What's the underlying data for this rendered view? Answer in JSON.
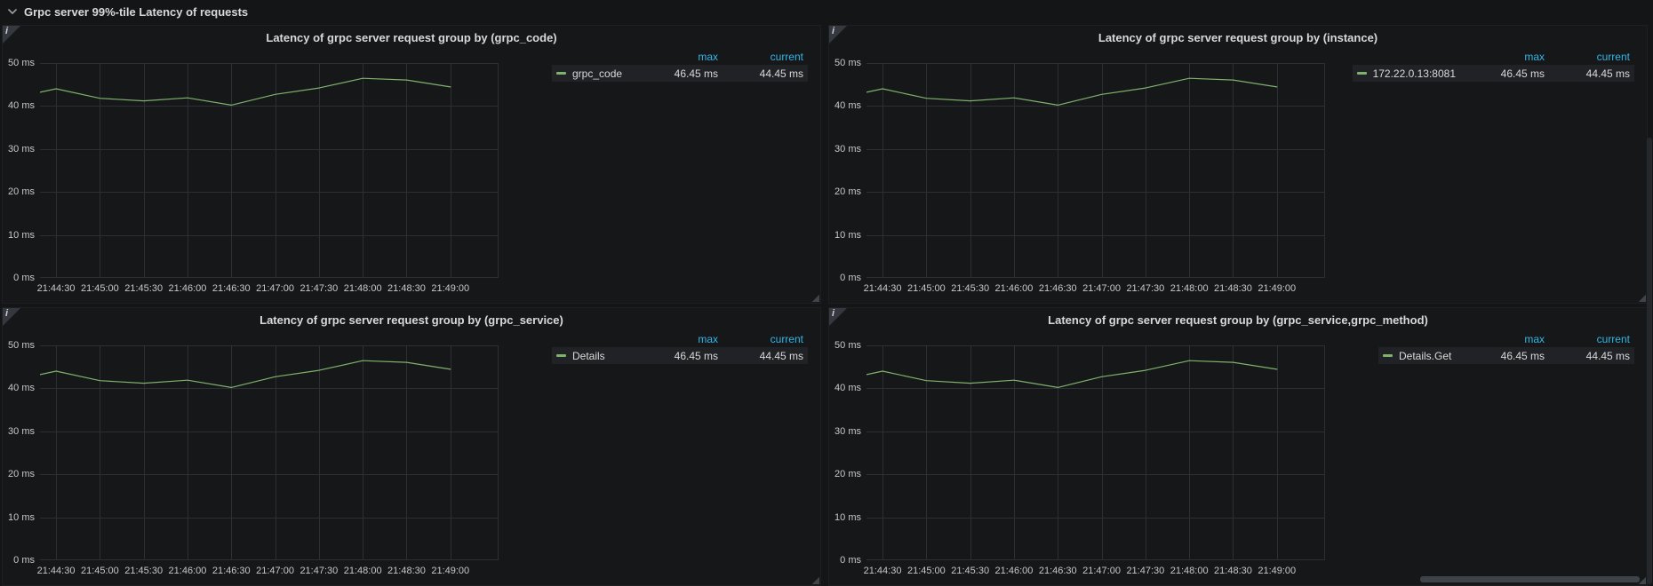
{
  "row_header": {
    "title": "Grpc server 99%-tile Latency of requests"
  },
  "legend_headers": {
    "max": "max",
    "current": "current"
  },
  "colors": {
    "line": "#7EB26D",
    "legend_header": "#33b5e5",
    "panel_bg": "#161719",
    "grid": "#2c2f34",
    "tick_text": "#c7c8c9"
  },
  "chart_data": {
    "type": "line",
    "shared": {
      "ylabel_unit": "ms",
      "y_domain": [
        0,
        50
      ],
      "t_domain": [
        -11,
        303
      ],
      "grid": true,
      "legend_position": "right-table",
      "y_ticks": [
        {
          "v": 0,
          "label": "0 ms"
        },
        {
          "v": 10,
          "label": "10 ms"
        },
        {
          "v": 20,
          "label": "20 ms"
        },
        {
          "v": 30,
          "label": "30 ms"
        },
        {
          "v": 40,
          "label": "40 ms"
        },
        {
          "v": 50,
          "label": "50 ms"
        }
      ],
      "x_ticks": [
        {
          "t": 0,
          "label": "21:44:30"
        },
        {
          "t": 30,
          "label": "21:45:00"
        },
        {
          "t": 60,
          "label": "21:45:30"
        },
        {
          "t": 90,
          "label": "21:46:00"
        },
        {
          "t": 120,
          "label": "21:46:30"
        },
        {
          "t": 150,
          "label": "21:47:00"
        },
        {
          "t": 180,
          "label": "21:47:30"
        },
        {
          "t": 210,
          "label": "21:48:00"
        },
        {
          "t": 240,
          "label": "21:48:30"
        },
        {
          "t": 270,
          "label": "21:49:00"
        }
      ],
      "points": [
        {
          "t": -11,
          "v": 43.2
        },
        {
          "t": 0,
          "v": 44.0
        },
        {
          "t": 30,
          "v": 41.8
        },
        {
          "t": 60,
          "v": 41.2
        },
        {
          "t": 90,
          "v": 41.9
        },
        {
          "t": 120,
          "v": 40.2
        },
        {
          "t": 150,
          "v": 42.7
        },
        {
          "t": 180,
          "v": 44.2
        },
        {
          "t": 210,
          "v": 46.45
        },
        {
          "t": 240,
          "v": 46.05
        },
        {
          "t": 270,
          "v": 44.45
        }
      ]
    },
    "panels": [
      {
        "title": "Latency of grpc server request group by (grpc_code)",
        "series": "grpc_code",
        "max": "46.45 ms",
        "current": "44.45 ms"
      },
      {
        "title": "Latency of grpc server request group by (instance)",
        "series": "172.22.0.13:8081",
        "max": "46.45 ms",
        "current": "44.45 ms"
      },
      {
        "title": "Latency of grpc server request group by (grpc_service)",
        "series": "Details",
        "max": "46.45 ms",
        "current": "44.45 ms"
      },
      {
        "title": "Latency of grpc server request group by (grpc_service,grpc_method)",
        "series": "Details.Get",
        "max": "46.45 ms",
        "current": "44.45 ms"
      }
    ]
  }
}
